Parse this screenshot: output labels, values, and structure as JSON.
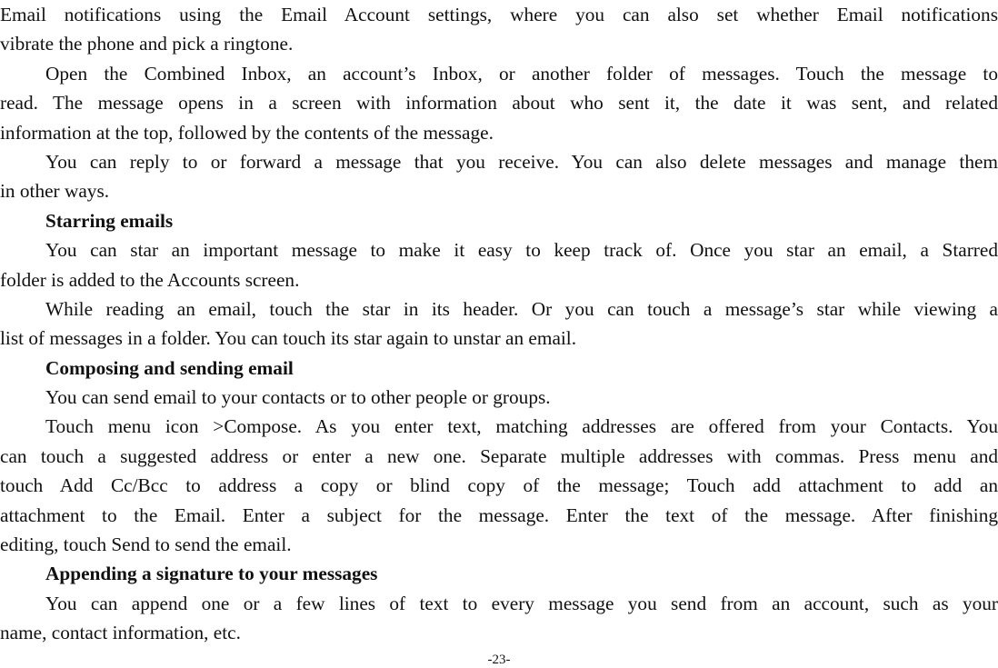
{
  "document": {
    "lines": [
      {
        "text": "Email notifications using the Email Account settings, where you can also set whether Email notifications",
        "indent": false,
        "justify": true,
        "heading": false
      },
      {
        "text": "vibrate the phone and pick a ringtone.",
        "indent": false,
        "justify": false,
        "heading": false
      },
      {
        "text": "Open the Combined Inbox, an account’s Inbox, or another folder of messages. Touch the message to",
        "indent": true,
        "justify": true,
        "heading": false
      },
      {
        "text": "read. The message opens in a screen with information about who sent it, the date it was sent, and related",
        "indent": false,
        "justify": true,
        "heading": false
      },
      {
        "text": "information at the top, followed by the contents of the message.",
        "indent": false,
        "justify": false,
        "heading": false
      },
      {
        "text": "You can reply to or forward a message that you receive. You can also delete messages and manage them",
        "indent": true,
        "justify": true,
        "heading": false
      },
      {
        "text": "in other ways.",
        "indent": false,
        "justify": false,
        "heading": false
      },
      {
        "text": "Starring emails",
        "indent": true,
        "justify": false,
        "heading": true
      },
      {
        "text": "You can star an important message to make it easy to keep track of. Once you star an email, a Starred",
        "indent": true,
        "justify": true,
        "heading": false
      },
      {
        "text": "folder is added to the Accounts screen.",
        "indent": false,
        "justify": false,
        "heading": false
      },
      {
        "text": "While reading an email, touch the star in its header. Or you can touch a message’s star while viewing a",
        "indent": true,
        "justify": true,
        "heading": false
      },
      {
        "text": "list of messages in a folder. You can touch its star again to unstar an email.",
        "indent": false,
        "justify": false,
        "heading": false
      },
      {
        "text": "Composing and sending email",
        "indent": true,
        "justify": false,
        "heading": true
      },
      {
        "text": "You can send email to your contacts or to other people or groups.",
        "indent": true,
        "justify": false,
        "heading": false
      },
      {
        "text": "Touch menu icon >Compose. As you enter text, matching addresses are offered from your Contacts. You",
        "indent": true,
        "justify": true,
        "heading": false
      },
      {
        "text": "can touch a suggested address or enter a new one. Separate multiple addresses with commas. Press menu and",
        "indent": false,
        "justify": true,
        "heading": false
      },
      {
        "text": "touch Add Cc/Bcc to address a copy or blind copy of the message; Touch add attachment to add an",
        "indent": false,
        "justify": true,
        "heading": false
      },
      {
        "text": "attachment to the Email. Enter a subject for the message. Enter the text of the message. After finishing",
        "indent": false,
        "justify": true,
        "heading": false
      },
      {
        "text": "editing, touch Send to send the email.",
        "indent": false,
        "justify": false,
        "heading": false
      },
      {
        "text": "Appending a signature to your messages",
        "indent": true,
        "justify": false,
        "heading": true
      },
      {
        "text": "You can append one or a few lines of text to every message you send from an account, such as your",
        "indent": true,
        "justify": true,
        "heading": false
      },
      {
        "text": "name, contact information, etc.",
        "indent": false,
        "justify": false,
        "heading": false
      }
    ],
    "page_number": "-23-"
  }
}
